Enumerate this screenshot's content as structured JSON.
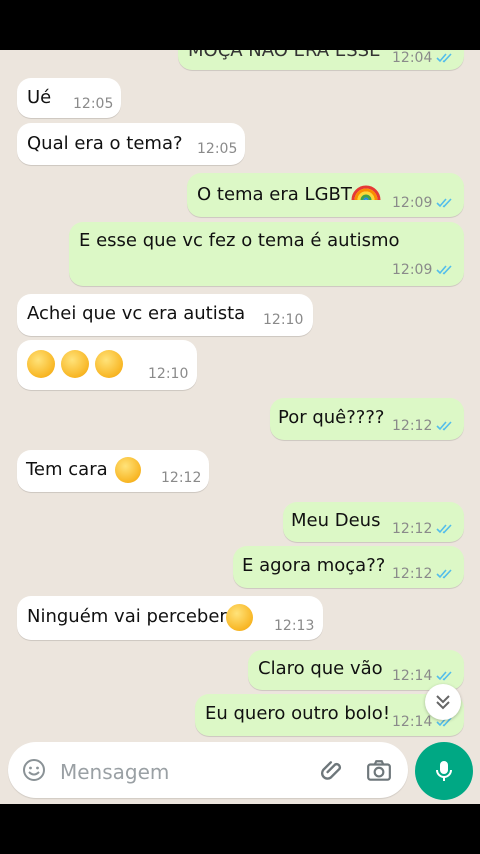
{
  "messages": [
    {
      "side": "out",
      "text": "MOÇA NÃO ERA ESSE",
      "time": "12:04",
      "read": true,
      "partial": true
    },
    {
      "side": "in",
      "text": "Ué",
      "time": "12:05"
    },
    {
      "side": "in",
      "text": "Qual era o tema?",
      "time": "12:05"
    },
    {
      "side": "out",
      "text": "O tema era LGBT",
      "emoji": "rainbow",
      "time": "12:09",
      "read": true
    },
    {
      "side": "out",
      "text": "E esse que vc fez o tema é autismo",
      "time": "12:09",
      "read": true
    },
    {
      "side": "in",
      "text": "Achei que vc era autista",
      "time": "12:10"
    },
    {
      "side": "in",
      "emoji": "thinking-face x3",
      "time": "12:10"
    },
    {
      "side": "out",
      "text": "Por quê????",
      "time": "12:12",
      "read": true
    },
    {
      "side": "in",
      "text": "Tem cara",
      "emoji": "face-with-hand-over-mouth",
      "time": "12:12"
    },
    {
      "side": "out",
      "text": "Meu Deus",
      "time": "12:12",
      "read": true
    },
    {
      "side": "out",
      "text": "E agora moça??",
      "time": "12:12",
      "read": true
    },
    {
      "side": "in",
      "text": "Ninguém vai perceber",
      "emoji": "star-struck",
      "time": "12:13"
    },
    {
      "side": "out",
      "text": "Claro que vão",
      "time": "12:14",
      "read": true
    },
    {
      "side": "out",
      "text": "Eu quero outro bolo!",
      "time": "12:14",
      "read": true
    }
  ],
  "composer": {
    "placeholder": "Mensagem",
    "icons": [
      "emoji-icon",
      "attach-icon",
      "camera-icon",
      "mic-icon"
    ]
  },
  "scroll_down_icon": "double-chevron-down-icon",
  "colors": {
    "chat_bg": "#ece5dd",
    "outgoing_bubble": "#dcf8c6",
    "incoming_bubble": "#ffffff",
    "read_tick": "#53bdeb",
    "accent": "#00a884"
  }
}
